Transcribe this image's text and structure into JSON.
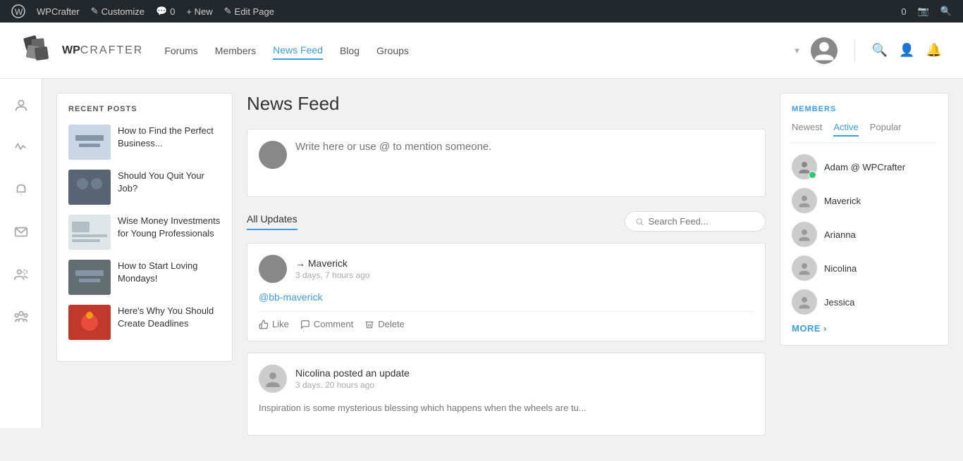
{
  "adminBar": {
    "items": [
      {
        "id": "wp-logo",
        "label": "WordPress",
        "icon": "⊞"
      },
      {
        "id": "wpcrafter",
        "label": "WPCrafter",
        "icon": "✎"
      },
      {
        "id": "customize",
        "label": "Customize",
        "icon": "✎"
      },
      {
        "id": "comments",
        "label": "0",
        "icon": "💬"
      },
      {
        "id": "new",
        "label": "+ New",
        "icon": ""
      },
      {
        "id": "edit-page",
        "label": "Edit Page",
        "icon": "✎"
      }
    ],
    "rightItems": [
      {
        "id": "counter",
        "label": "0"
      },
      {
        "id": "search",
        "icon": "🔍"
      }
    ]
  },
  "header": {
    "logo": {
      "text": "WP",
      "subtext": "CRAFTER"
    },
    "nav": [
      {
        "id": "forums",
        "label": "Forums",
        "active": false
      },
      {
        "id": "members",
        "label": "Members",
        "active": false
      },
      {
        "id": "news-feed",
        "label": "News Feed",
        "active": true
      },
      {
        "id": "blog",
        "label": "Blog",
        "active": false
      },
      {
        "id": "groups",
        "label": "Groups",
        "active": false
      }
    ]
  },
  "sidebar": {
    "icons": [
      {
        "id": "user",
        "icon": "person",
        "label": "Profile"
      },
      {
        "id": "activity",
        "icon": "activity",
        "label": "Activity"
      },
      {
        "id": "notifications",
        "icon": "bell",
        "label": "Notifications"
      },
      {
        "id": "messages",
        "icon": "message",
        "label": "Messages"
      },
      {
        "id": "friends",
        "icon": "friends",
        "label": "Friends"
      },
      {
        "id": "groups",
        "icon": "group",
        "label": "Groups"
      }
    ]
  },
  "recentPosts": {
    "title": "RECENT POSTS",
    "items": [
      {
        "id": "post-1",
        "title": "How to Find the Perfect Business...",
        "thumb": "1"
      },
      {
        "id": "post-2",
        "title": "Should You Quit Your Job?",
        "thumb": "2"
      },
      {
        "id": "post-3",
        "title": "Wise Money Investments for Young Professionals",
        "thumb": "3"
      },
      {
        "id": "post-4",
        "title": "How to Start Loving Mondays!",
        "thumb": "4"
      },
      {
        "id": "post-5",
        "title": "Here's Why You Should Create Deadlines",
        "thumb": "5"
      }
    ]
  },
  "feed": {
    "title": "News Feed",
    "writePlaceholder": "Write here or use @ to mention someone.",
    "updatesTab": "All Updates",
    "searchPlaceholder": "Search Feed...",
    "posts": [
      {
        "id": "post-maverick",
        "author": "Maverick",
        "action": "→ Maverick",
        "time": "3 days, 7 hours ago",
        "content": "@bb-maverick",
        "actions": [
          "Like",
          "Comment",
          "Delete"
        ]
      },
      {
        "id": "post-nicolina",
        "author": "Nicolina",
        "action": "Nicolina posted an update",
        "time": "3 days, 20 hours ago",
        "content": "Inspiration is some mysterious blessing which happens when the wheels are tu..."
      }
    ]
  },
  "members": {
    "title": "MEMBERS",
    "tabs": [
      "Newest",
      "Active",
      "Popular"
    ],
    "activeTab": "Active",
    "items": [
      {
        "id": "adam",
        "name": "Adam @ WPCrafter",
        "online": true
      },
      {
        "id": "maverick",
        "name": "Maverick",
        "online": false
      },
      {
        "id": "arianna",
        "name": "Arianna",
        "online": false
      },
      {
        "id": "nicolina",
        "name": "Nicolina",
        "online": false
      },
      {
        "id": "jessica",
        "name": "Jessica",
        "online": false
      }
    ],
    "moreLabel": "MORE"
  }
}
